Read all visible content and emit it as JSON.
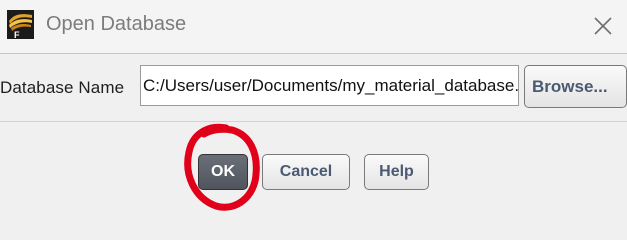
{
  "window": {
    "title": "Open Database",
    "app_icon": "fluent-app-icon",
    "close_icon": "close-icon"
  },
  "form": {
    "database_label": "Database Name",
    "database_value": "C:/Users/user/Documents/my_material_database.scm",
    "browse_label": "Browse..."
  },
  "actions": {
    "ok_label": "OK",
    "cancel_label": "Cancel",
    "help_label": "Help"
  },
  "annotation": {
    "type": "hand-drawn circle",
    "color": "#e0001a",
    "target": "ok-button"
  },
  "colors": {
    "ok_button_bg": "#5a5f68",
    "button_text": "#4a5a72",
    "title_text": "#7c7c7c",
    "annotation": "#e0001a"
  }
}
